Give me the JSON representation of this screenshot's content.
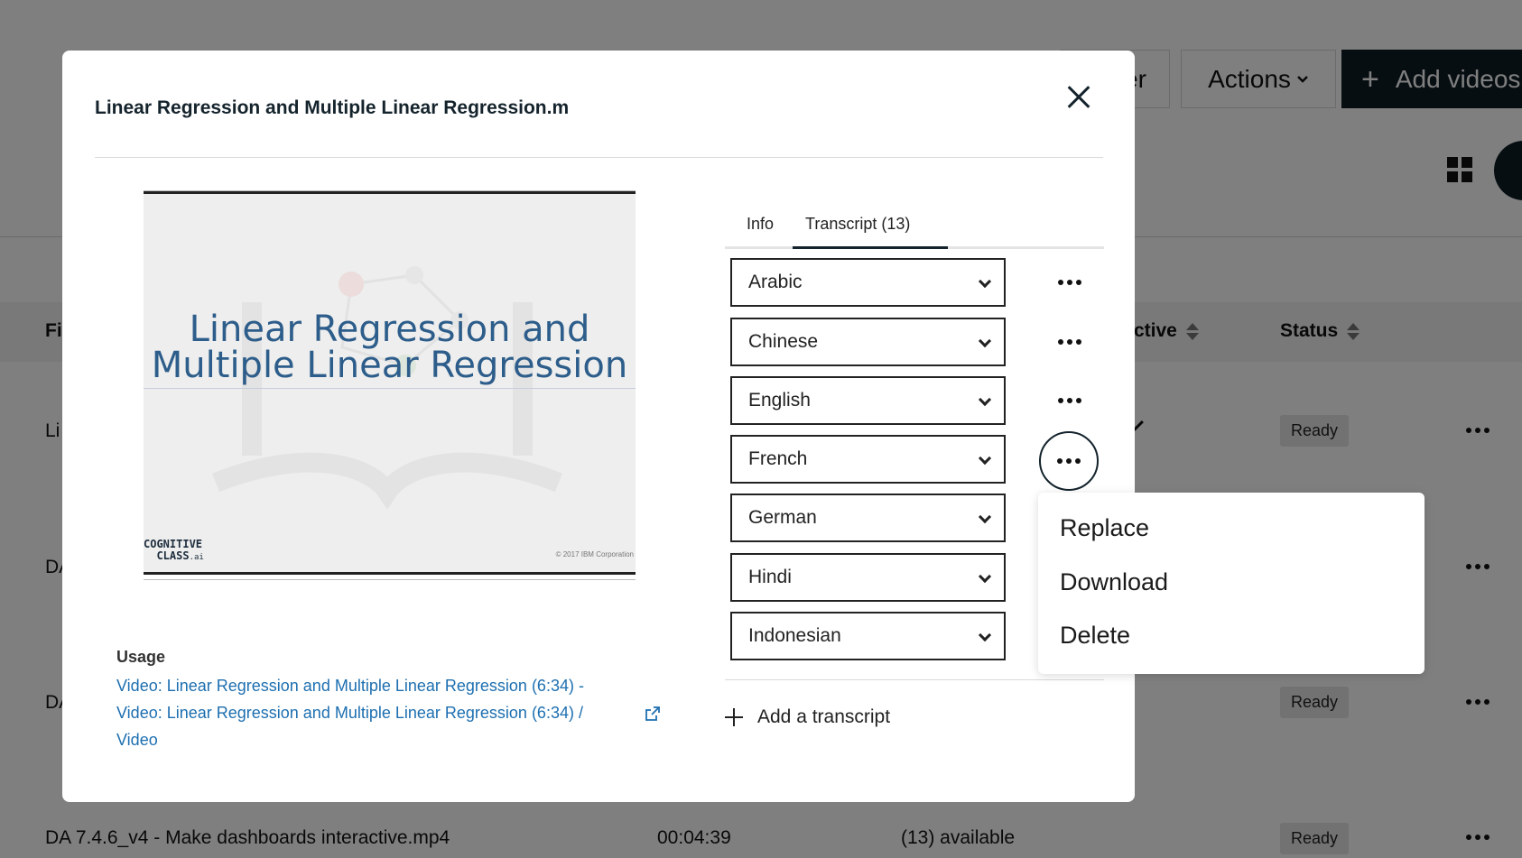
{
  "background": {
    "filter_button_fragment": "er",
    "actions_label": "Actions",
    "add_videos_label": "Add videos",
    "table_headers": {
      "filename_fragment": "Fi",
      "active_fragment": "ctive",
      "status": "Status"
    },
    "rows": [
      {
        "name_fragment": "Li",
        "status": "Ready"
      },
      {
        "name_fragment": "DA",
        "status": ""
      },
      {
        "name_fragment": "DA",
        "status": "Ready"
      },
      {
        "name": "DA 7.4.6_v4 - Make dashboards interactive.mp4",
        "duration": "00:04:39",
        "transcripts": "(13) available",
        "status": "Ready"
      }
    ]
  },
  "modal": {
    "title": "Linear Regression and Multiple Linear Regression.m",
    "video": {
      "slide_title": "Linear Regression and Multiple Linear Regression",
      "logo_line1": "COGNITIVE",
      "logo_line2": "CLASS",
      "logo_suffix": ".ai",
      "copyright": "© 2017 IBM Corporation"
    },
    "usage": {
      "label": "Usage",
      "link_text": "Video: Linear Regression and Multiple Linear Regression (6:34) - Video: Linear Regression and Multiple Linear Regression (6:34) / Video"
    },
    "tabs": [
      {
        "label": "Info"
      },
      {
        "label": "Transcript (13)"
      }
    ],
    "languages": [
      "Arabic",
      "Chinese",
      "English",
      "French",
      "German",
      "Hindi",
      "Indonesian"
    ],
    "add_transcript_label": "Add a transcript",
    "context_menu": [
      "Replace",
      "Download",
      "Delete"
    ],
    "colors": {
      "primary_dark": "#14232c",
      "link": "#1d6fb0",
      "overlay": "rgba(0,0,0,0.5)"
    }
  }
}
